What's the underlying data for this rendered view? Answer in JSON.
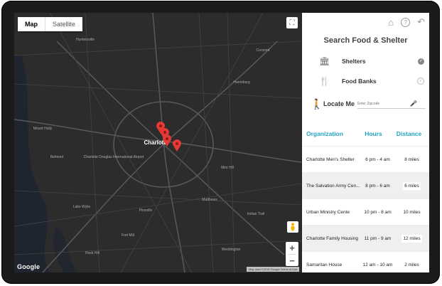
{
  "map": {
    "type_buttons": [
      "Map",
      "Satellite"
    ],
    "active_type": "Map",
    "google_logo": "Google",
    "footer": "Map data ©2016 Google   Terms of Use",
    "zoom_in": "+",
    "zoom_out": "−",
    "city_label": "Charlotte",
    "place_labels": [
      {
        "text": "Huntersville",
        "cls": ""
      },
      {
        "text": "Concord",
        "cls": ""
      },
      {
        "text": "Harrisburg",
        "cls": ""
      },
      {
        "text": "Mount Holly",
        "cls": ""
      },
      {
        "text": "Belmont",
        "cls": ""
      },
      {
        "text": "Charlotte Douglas International Airport",
        "cls": ""
      },
      {
        "text": "Mint Hill",
        "cls": ""
      },
      {
        "text": "Matthews",
        "cls": ""
      },
      {
        "text": "Pineville",
        "cls": ""
      },
      {
        "text": "Fort Mill",
        "cls": ""
      },
      {
        "text": "Indian Trail",
        "cls": ""
      },
      {
        "text": "Weddington",
        "cls": ""
      },
      {
        "text": "Rock Hill",
        "cls": ""
      },
      {
        "text": "Lake Wylie",
        "cls": ""
      }
    ],
    "marker_color": "#e53935"
  },
  "panel": {
    "title": "Search Food & Shelter",
    "icons": [
      "home-icon",
      "help-icon",
      "back-icon"
    ],
    "filters": [
      {
        "label": "Shelters",
        "checked": true
      },
      {
        "label": "Food Banks",
        "checked": false
      }
    ],
    "locate": {
      "label": "Locate Me",
      "placeholder": "Enter Zipcode"
    },
    "columns": [
      "Organization",
      "Hours",
      "Distance"
    ],
    "header_color": "#22a3c4",
    "rows": [
      {
        "org": "Charlotte Men's Shelter",
        "hours": "6 pm - 4 am",
        "distance": "8 miles"
      },
      {
        "org": "The Salvation Army Cen...",
        "hours": "8 pm - 6 am",
        "distance": "6 miles"
      },
      {
        "org": "Urban Ministry Cente",
        "hours": "10 pm - 8 am",
        "distance": "10 miles"
      },
      {
        "org": "Charlotte Family Housing",
        "hours": "11 pm - 9 am",
        "distance": "12 miles"
      },
      {
        "org": "Samaritan House",
        "hours": "12 am - 10 am",
        "distance": "2 miles"
      }
    ]
  }
}
